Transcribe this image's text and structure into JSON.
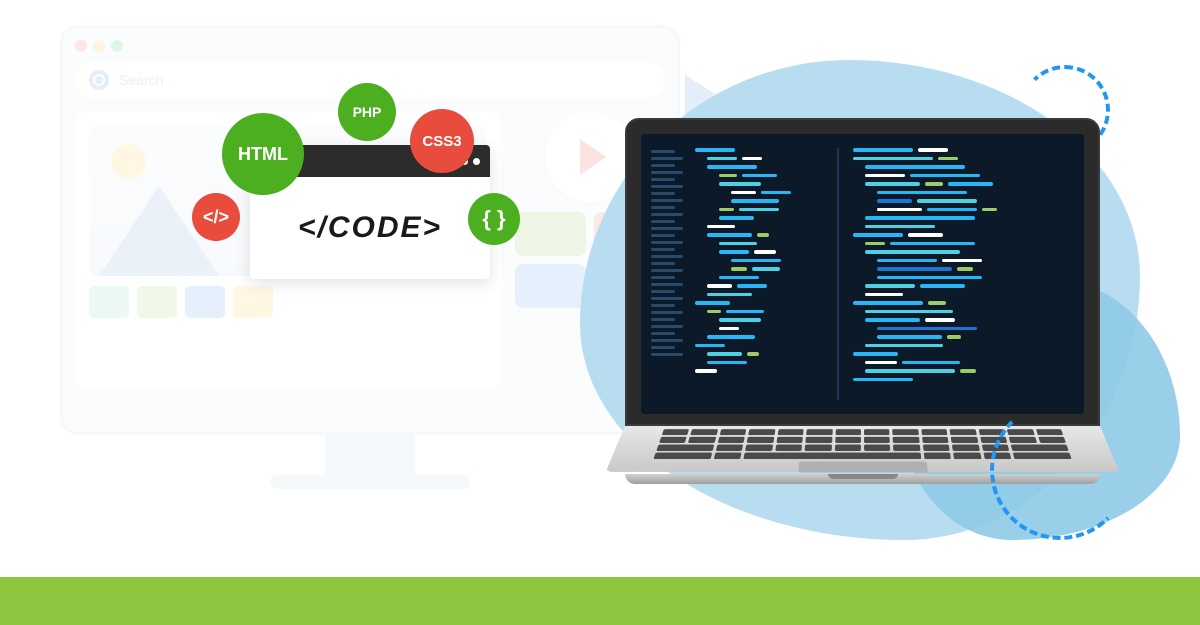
{
  "desktop": {
    "search_placeholder": "Search"
  },
  "code_window": {
    "body_text": "</CODE>"
  },
  "badges": {
    "html": "HTML",
    "php": "PHP",
    "css3": "CSS3",
    "tag": "</>",
    "braces": "{ }"
  },
  "colors": {
    "green_bar": "#8CC63F",
    "badge_green": "#4CAF1F",
    "badge_red": "#E74C3C",
    "blob_light": "#B8DDF0",
    "blob_mid": "#8ECAE6",
    "dash_blue": "#2196F3",
    "editor_bg": "#0B1929"
  }
}
